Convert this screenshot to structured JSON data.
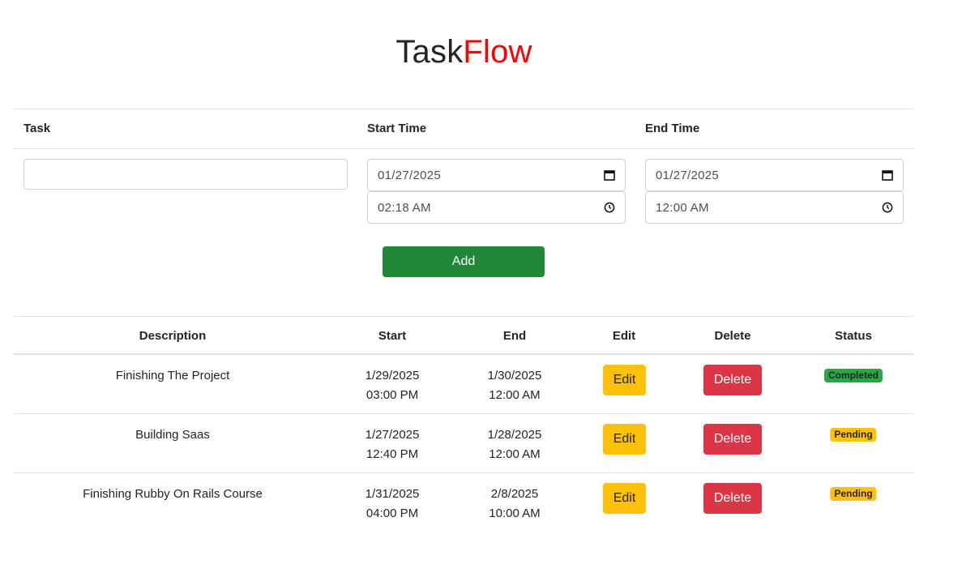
{
  "header": {
    "title_part1": "Task",
    "title_part2": "Flow"
  },
  "form": {
    "columns": {
      "task": "Task",
      "start": "Start Time",
      "end": "End Time"
    },
    "task_value": "",
    "start_date": "01/27/2025",
    "start_time": "02:18 AM",
    "end_date": "01/27/2025",
    "end_time": "12:00 AM",
    "add_label": "Add"
  },
  "table": {
    "headers": {
      "description": "Description",
      "start": "Start",
      "end": "End",
      "edit": "Edit",
      "delete": "Delete",
      "status": "Status"
    },
    "rows": [
      {
        "description": "Finishing The Project",
        "start_date": "1/29/2025",
        "start_time": "03:00 PM",
        "end_date": "1/30/2025",
        "end_time": "12:00 AM",
        "edit": "Edit",
        "delete": "Delete",
        "status": "Completed"
      },
      {
        "description": "Building Saas",
        "start_date": "1/27/2025",
        "start_time": "12:40 PM",
        "end_date": "1/28/2025",
        "end_time": "12:00 AM",
        "edit": "Edit",
        "delete": "Delete",
        "status": "Pending"
      },
      {
        "description": "Finishing Rubby On Rails Course",
        "start_date": "1/31/2025",
        "start_time": "04:00 PM",
        "end_date": "2/8/2025",
        "end_time": "10:00 AM",
        "edit": "Edit",
        "delete": "Delete",
        "status": "Pending"
      }
    ]
  },
  "colors": {
    "brand_red": "#ff0000",
    "add_green": "#218838",
    "edit_yellow": "#ffc107",
    "delete_red": "#dc3545",
    "completed_green": "#28a745"
  }
}
